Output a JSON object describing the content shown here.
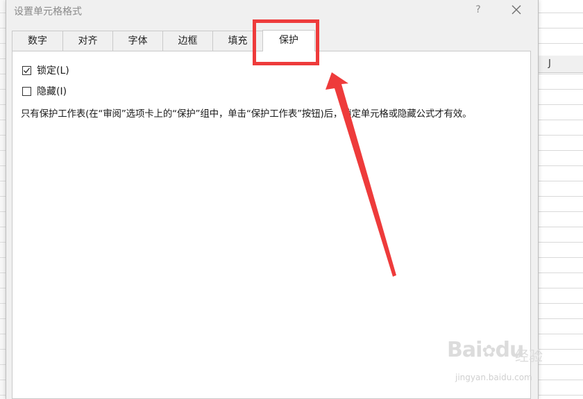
{
  "dialog": {
    "title": "设置单元格格式",
    "help_label": "?",
    "close_icon": "close-icon"
  },
  "tabs": [
    {
      "label": "数字",
      "active": false
    },
    {
      "label": "对齐",
      "active": false
    },
    {
      "label": "字体",
      "active": false
    },
    {
      "label": "边框",
      "active": false
    },
    {
      "label": "填充",
      "active": false
    },
    {
      "label": "保护",
      "active": true
    }
  ],
  "protection": {
    "locked": {
      "label": "锁定(L)",
      "checked": true
    },
    "hidden": {
      "label": "隐藏(I)",
      "checked": false
    },
    "description": "只有保护工作表(在“审阅”选项卡上的“保护”组中，单击“保护工作表”按钮)后，锁定单元格或隐藏公式才有效。"
  },
  "background_sheet": {
    "column_header": "J"
  },
  "annotation": {
    "color": "#ee3b3b"
  },
  "watermark": {
    "logo": "Bai",
    "logo2": "du",
    "text": "经验",
    "url": "jingyan.baidu.com"
  }
}
